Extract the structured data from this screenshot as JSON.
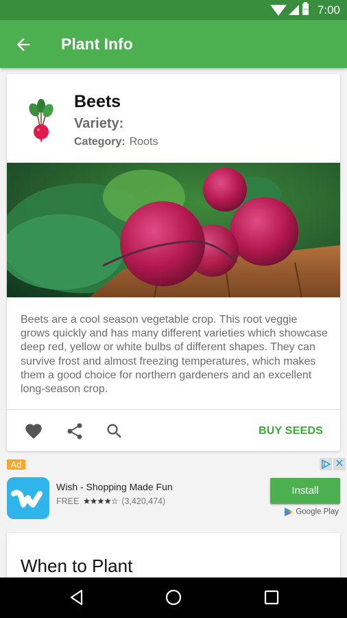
{
  "status_bar": {
    "time": "7:00",
    "battery_level": "100",
    "icons": [
      "wifi-icon",
      "cell-signal-icon",
      "battery-icon"
    ]
  },
  "app_bar": {
    "title": "Plant Info",
    "back_icon": "arrow-left-icon",
    "color": "#4caf50",
    "status_color": "#388e3c"
  },
  "plant": {
    "name": "Beets",
    "variety_label": "Variety:",
    "variety_value": "",
    "category_label": "Category:",
    "category_value": "Roots",
    "icon": "beet-icon",
    "photo_alt": "Fresh beets with green leaves on a wooden table",
    "description": "Beets are a cool season vegetable crop. This root veggie grows quickly and has many different varieties which showcase deep red, yellow or white bulbs of different shapes. They can survive frost and almost freezing temperatures, which makes them a good choice for northern gardeners and an excellent long-season crop."
  },
  "actions": {
    "favorite_icon": "heart-icon",
    "share_icon": "share-icon",
    "search_icon": "search-icon",
    "buy_label": "BUY SEEDS",
    "accent_color": "#3aaa35"
  },
  "ad": {
    "badge": "Ad",
    "close_glyph": "✕",
    "app_name": "Wish - Shopping Made Fun",
    "price": "FREE",
    "rating": 4.5,
    "stars": "★★★★☆",
    "review_count": "(3,420,474)",
    "install_label": "Install",
    "store_label": "Google Play"
  },
  "section": {
    "title": "When to Plant"
  },
  "nav_bar": {
    "icons": [
      "back-triangle-icon",
      "home-circle-icon",
      "recents-square-icon"
    ]
  }
}
